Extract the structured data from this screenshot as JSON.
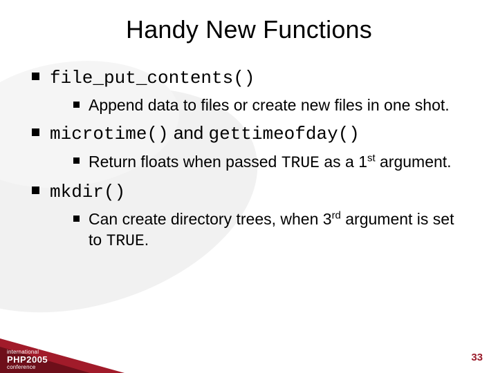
{
  "title": "Handy New Functions",
  "bullets": [
    {
      "prefix_mono": "file_put_contents()",
      "text_after": "",
      "sub": [
        {
          "text": "Append data to files or create new files in one shot."
        }
      ]
    },
    {
      "prefix_mono": "microtime()",
      "mid_text": " and ",
      "suffix_mono": "gettimeofday()",
      "sub": [
        {
          "pre": "Return floats when passed ",
          "mono": "TRUE",
          "mid": " as a 1",
          "sup": "st",
          "post": " argument."
        }
      ]
    },
    {
      "prefix_mono": "mkdir()",
      "text_after": "",
      "sub": [
        {
          "pre": "Can create directory trees, when 3",
          "sup": "rd",
          "mid": " argument is set to ",
          "mono": "TRUE",
          "post": "."
        }
      ]
    }
  ],
  "footer": {
    "logo_top": "international",
    "logo_brand": "PHP2005",
    "logo_bottom": "conference",
    "page_number": "33"
  }
}
